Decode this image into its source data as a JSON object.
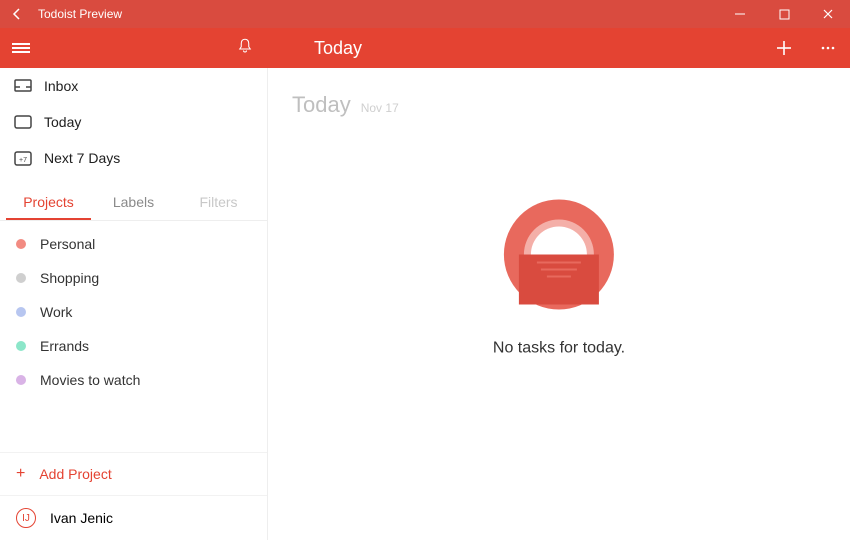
{
  "window": {
    "title": "Todoist Preview"
  },
  "header": {
    "pageTitle": "Today"
  },
  "sidebar": {
    "nav": [
      {
        "label": "Inbox"
      },
      {
        "label": "Today"
      },
      {
        "label": "Next 7 Days"
      }
    ],
    "tabs": {
      "projects": "Projects",
      "labels": "Labels",
      "filters": "Filters"
    },
    "projects": [
      {
        "label": "Personal",
        "color": "#f28b82"
      },
      {
        "label": "Shopping",
        "color": "#cfcfcf"
      },
      {
        "label": "Work",
        "color": "#b7c6f0"
      },
      {
        "label": "Errands",
        "color": "#8ce6c9"
      },
      {
        "label": "Movies to watch",
        "color": "#d9b3e6"
      }
    ],
    "addProject": "Add Project",
    "user": {
      "initial": "IJ",
      "name": "Ivan Jenic"
    }
  },
  "main": {
    "title": "Today",
    "dateLabel": "Nov 17",
    "emptyMessage": "No tasks for today."
  }
}
